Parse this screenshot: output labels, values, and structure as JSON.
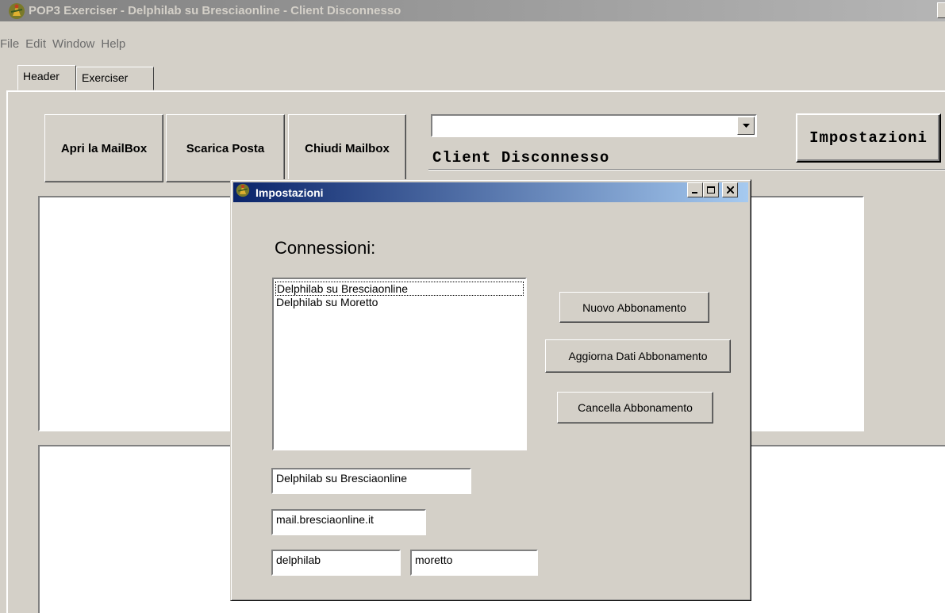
{
  "window": {
    "title": "POP3 Exerciser - Delphilab su Bresciaonline - Client Disconnesso"
  },
  "menu": [
    "File",
    "Edit",
    "Window",
    "Help"
  ],
  "tabs": [
    {
      "label": "Header",
      "active": true
    },
    {
      "label": "Exerciser",
      "active": false
    }
  ],
  "toolbar": {
    "open_label": "Apri la MailBox",
    "download_label": "Scarica Posta",
    "close_label": "Chiudi Mailbox",
    "combo_value": "",
    "status": "Client Disconnesso",
    "settings_label": "Impostazioni"
  },
  "dialog": {
    "title": "Impostazioni",
    "section_label": "Connessioni:",
    "connections": [
      "Delphilab su Bresciaonline",
      "Delphilab su Moretto"
    ],
    "selected_index": 0,
    "new_label": "Nuovo Abbonamento",
    "update_label": "Aggiorna Dati Abbonamento",
    "delete_label": "Cancella Abbonamento",
    "fields": {
      "name": "Delphilab su Bresciaonline",
      "server": "mail.bresciaonline.it",
      "username": "delphilab",
      "password": "moretto"
    }
  },
  "colors": {
    "face": "#d4d0c8",
    "active_title_start": "#0a246a",
    "active_title_end": "#a6caf0",
    "inactive_title": "#808080"
  },
  "icons": {
    "app": "app-figure-icon",
    "combo_arrow": "chevron-down-icon"
  }
}
